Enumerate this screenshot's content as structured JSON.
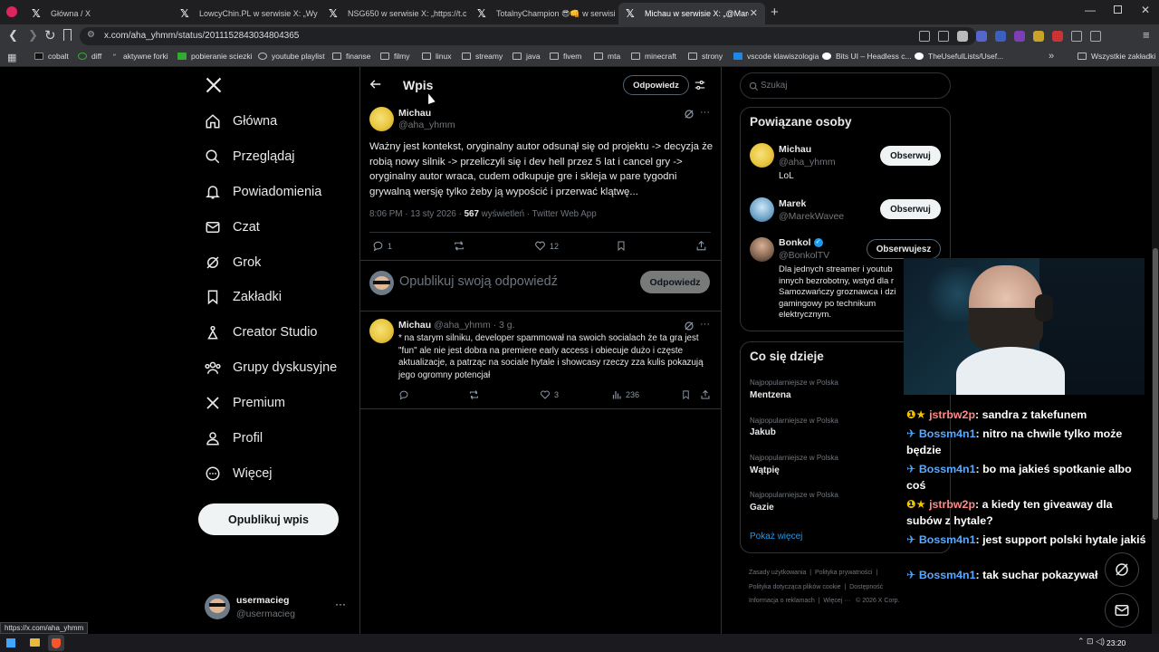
{
  "browser": {
    "tabs": [
      {
        "title": "Główna / X",
        "active": false
      },
      {
        "title": "LowcyChin.PL w serwisie X: „Wyprzed",
        "active": false
      },
      {
        "title": "NSG650 w serwisie X: „https://t.co/llt",
        "active": false
      },
      {
        "title": "TotalnyChampion 😎👊 w serwisie X",
        "active": false
      },
      {
        "title": "Michau w serwisie X: „@MarekW",
        "active": true
      }
    ],
    "url": "x.com/aha_yhmm/status/2011152843034804365",
    "bookmarks": [
      "cobalt",
      "diff",
      "aktywne forki",
      "pobieranie sciezki",
      "youtube playlist",
      "finanse",
      "filmy",
      "linux",
      "streamy",
      "java",
      "fivem",
      "mta",
      "minecraft",
      "strony",
      "vscode klawiszologia",
      "Bits UI – Headless c...",
      "TheUsefulLists/Usef..."
    ],
    "bookmarks_other": "Wszystkie zakładki",
    "status_url": "https://x.com/aha_yhmm"
  },
  "sidebar": {
    "items": [
      {
        "label": "Główna",
        "icon": "home-icon"
      },
      {
        "label": "Przeglądaj",
        "icon": "search-icon"
      },
      {
        "label": "Powiadomienia",
        "icon": "bell-icon"
      },
      {
        "label": "Czat",
        "icon": "mail-icon"
      },
      {
        "label": "Grok",
        "icon": "grok-icon"
      },
      {
        "label": "Zakładki",
        "icon": "bookmark-icon"
      },
      {
        "label": "Creator Studio",
        "icon": "creator-icon"
      },
      {
        "label": "Grupy dyskusyjne",
        "icon": "communities-icon"
      },
      {
        "label": "Premium",
        "icon": "x-logo-icon"
      },
      {
        "label": "Profil",
        "icon": "profile-icon"
      },
      {
        "label": "Więcej",
        "icon": "more-circle-icon"
      }
    ],
    "post_button": "Opublikuj wpis",
    "account": {
      "name": "usermacieg",
      "handle": "@usermacieg"
    }
  },
  "header": {
    "title": "Wpis",
    "reply_button": "Odpowiedz"
  },
  "main_post": {
    "author": "Michau",
    "handle": "@aha_yhmm",
    "text": "Ważny jest kontekst, oryginalny autor odsunął się od projektu -> decyzja że robią nowy silnik -> przeliczyli się i dev hell przez 5 lat i cancel gry -> oryginalny autor wraca, cudem odkupuje gre i skleja w pare tygodni grywalną wersję tylko żeby ją wypościć i przerwać klątwę...",
    "time": "8:06 PM · 13 sty 2026 · ",
    "views": "567",
    "views_label": " wyświetleń · ",
    "source": "Twitter Web App",
    "replies": "1",
    "likes": "12"
  },
  "composer": {
    "placeholder": "Opublikuj swoją odpowiedź",
    "button": "Odpowiedz"
  },
  "reply_post": {
    "author": "Michau",
    "handle": "@aha_yhmm",
    "time": "· 3 g.",
    "text": "* na starym silniku, developer spammował na swoich socialach że ta gra jest \"fun\" ale nie jest dobra na premiere early access i obiecuje dużo i częste aktualizacje, a patrząc na sociale hytale i showcasy rzeczy zza kulis pokazują jego ogromny potencjał",
    "likes": "3",
    "views": "236"
  },
  "search": {
    "placeholder": "Szukaj"
  },
  "related": {
    "title": "Powiązane osoby",
    "people": [
      {
        "name": "Michau",
        "handle": "@aha_yhmm",
        "bio": "LoL",
        "button": "Obserwuj"
      },
      {
        "name": "Marek",
        "handle": "@MarekWavee",
        "bio": "",
        "button": "Obserwuj"
      },
      {
        "name": "Bonkol",
        "handle": "@BonkolTV",
        "bio": "Dla jednych streamer i youtub innych bezrobotny, wstyd dla r Samozwańczy groznawca i dzi gamingowy po technikum elektrycznym.",
        "button": "Obserwujesz"
      }
    ]
  },
  "trends": {
    "title": "Co się dzieje",
    "items": [
      {
        "context": "Najpopularniejsze w Polska",
        "name": "Mentzena"
      },
      {
        "context": "Najpopularniejsze w Polska",
        "name": "Jakub"
      },
      {
        "context": "Najpopularniejsze w Polska",
        "name": "Wątpię"
      },
      {
        "context": "Najpopularniejsze w Polska",
        "name": "Gazie"
      }
    ],
    "show_more": "Pokaż więcej"
  },
  "footer": {
    "links": [
      "Zasady użytkowania",
      "Polityka prywatności",
      "Polityka dotycząca plików cookie",
      "Dostępność",
      "Informacja o reklamach",
      "Więcej ···",
      "© 2026 X Corp."
    ]
  },
  "stream_chat": [
    {
      "user": "jstrbw2p",
      "text": ": sandra z takefunem",
      "type": "sub"
    },
    {
      "user": "Bossm4n1",
      "text": ": nitro na chwile tylko może będzie",
      "type": "mod"
    },
    {
      "user": "Bossm4n1",
      "text": ": bo ma jakieś spotkanie albo coś",
      "type": "mod"
    },
    {
      "user": "jstrbw2p",
      "text": ": a kiedy ten giveaway dla subów z hytale?",
      "type": "sub"
    },
    {
      "user": "Bossm4n1",
      "text": ": jest support polski hytale jakiś",
      "type": "mod"
    },
    {
      "user": "Bossm4n1",
      "text": ": tak suchar pokazywał",
      "type": "mod"
    }
  ],
  "taskbar": {
    "time": "23:20"
  }
}
